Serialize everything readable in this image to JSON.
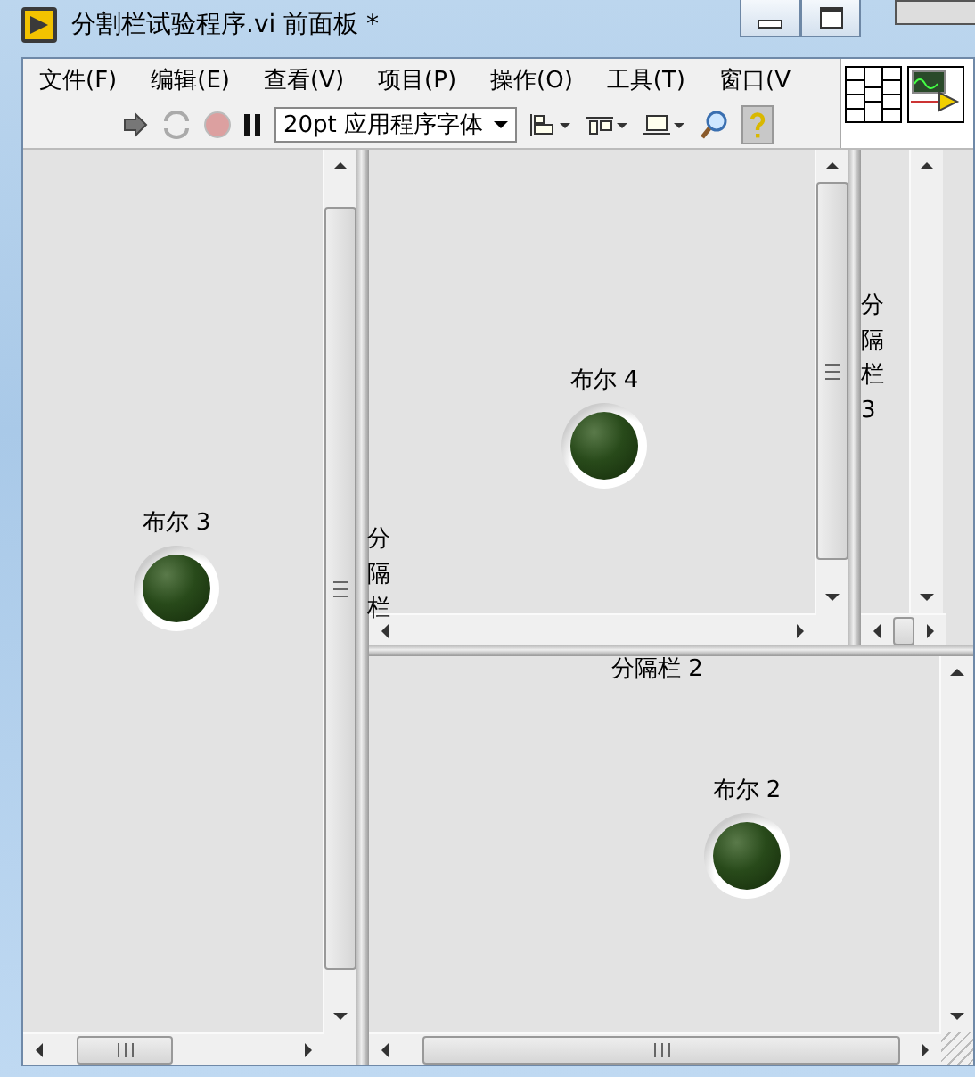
{
  "window": {
    "title": "分割栏试验程序.vi 前面板 *"
  },
  "menu": [
    {
      "label": "文件(F)"
    },
    {
      "label": "编辑(E)"
    },
    {
      "label": "查看(V)"
    },
    {
      "label": "项目(P)"
    },
    {
      "label": "操作(O)"
    },
    {
      "label": "工具(T)"
    },
    {
      "label": "窗口(V"
    }
  ],
  "toolbar": {
    "font": "20pt 应用程序字体"
  },
  "booleans": [
    {
      "label": "布尔 3",
      "on": false
    },
    {
      "label": "布尔 4",
      "on": false
    },
    {
      "label": "布尔 2",
      "on": false
    }
  ],
  "splitters": [
    {
      "label": "分隔栏",
      "kind": "vertical"
    },
    {
      "label": "分隔栏 3",
      "kind": "vertical"
    },
    {
      "label": "分隔栏 2",
      "kind": "horizontal"
    }
  ]
}
